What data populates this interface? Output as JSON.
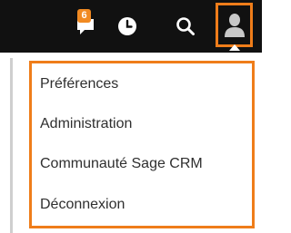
{
  "toolbar": {
    "notifications": {
      "icon": "notification-icon",
      "count": "6",
      "badge_color": "#f18a22"
    },
    "recent": {
      "icon": "clock-icon"
    },
    "search": {
      "icon": "search-icon"
    },
    "user": {
      "icon": "user-icon"
    }
  },
  "menu": {
    "items": [
      {
        "label": "Préférences"
      },
      {
        "label": "Administration"
      },
      {
        "label": "Communauté Sage CRM"
      },
      {
        "label": "Déconnexion"
      }
    ]
  },
  "colors": {
    "topbar": "#111111",
    "highlight": "#ef7d1a",
    "text": "#2f2f2f"
  }
}
